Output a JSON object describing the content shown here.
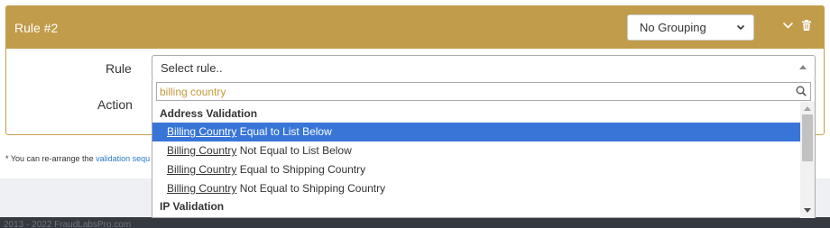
{
  "rule_card": {
    "title": "Rule #2",
    "grouping_value": "No Grouping",
    "rule_label": "Rule",
    "action_label": "Action"
  },
  "select": {
    "placeholder": "Select rule..",
    "search_value": "billing country"
  },
  "dropdown": {
    "groups": [
      {
        "label": "Address Validation",
        "options": [
          {
            "match": "Billing Country",
            "rest": " Equal to List Below",
            "highlighted": true
          },
          {
            "match": "Billing Country",
            "rest": " Not Equal to List Below",
            "highlighted": false
          },
          {
            "match": "Billing Country",
            "rest": " Equal to Shipping Country",
            "highlighted": false
          },
          {
            "match": "Billing Country",
            "rest": " Not Equal to Shipping Country",
            "highlighted": false
          }
        ]
      },
      {
        "label": "IP Validation",
        "options": []
      }
    ]
  },
  "note": {
    "text": "* You can re-arrange the ",
    "link": "validation sequ"
  },
  "footer": {
    "text": "2013 - 2022 FraudLabsPro.com"
  },
  "colors": {
    "header": "#c19c4a",
    "highlight": "#3875d7",
    "search_text": "#c39a3c",
    "footer_bg": "#353a40"
  }
}
